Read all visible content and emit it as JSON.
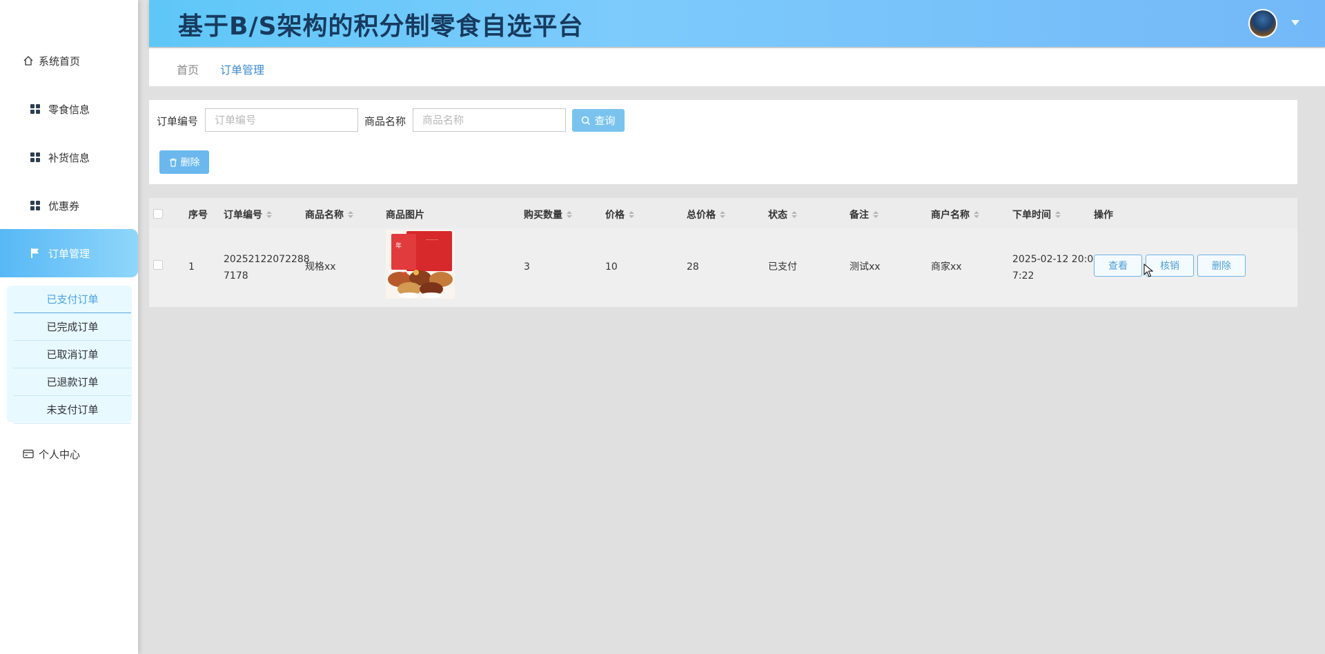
{
  "header": {
    "title": "基于B/S架构的积分制零食自选平台"
  },
  "sidebar": {
    "items": {
      "home": "系统首页",
      "snack": "零食信息",
      "restock": "补货信息",
      "coupon": "优惠券",
      "orders": "订单管理",
      "profile": "个人中心"
    },
    "submenu": [
      "已支付订单",
      "已完成订单",
      "已取消订单",
      "已退款订单",
      "未支付订单"
    ]
  },
  "breadcrumb": {
    "home": "首页",
    "current": "订单管理"
  },
  "search": {
    "order_no_label": "订单编号",
    "order_no_placeholder": "订单编号",
    "product_label": "商品名称",
    "product_placeholder": "商品名称",
    "search_button": "查询",
    "delete_button": "删除"
  },
  "table": {
    "columns": {
      "index": "序号",
      "order_no": "订单编号",
      "product": "商品名称",
      "image": "商品图片",
      "quantity": "购买数量",
      "price": "价格",
      "total": "总价格",
      "status": "状态",
      "remark": "备注",
      "merchant": "商户名称",
      "time": "下单时间",
      "actions": "操作"
    },
    "rows": [
      {
        "index": "1",
        "order_no_line1": "20252122072288",
        "order_no_line2": "7178",
        "product": "规格xx",
        "quantity": "3",
        "price": "10",
        "total": "28",
        "status": "已支付",
        "remark": "测试xx",
        "merchant": "商家xx",
        "time_line1": "2025-02-12 20:0",
        "time_line2": "7:22",
        "view": "查看",
        "verify": "核销",
        "delete": "删除"
      }
    ]
  },
  "colors": {
    "header_gradient_start": "#5ec7f8",
    "active_menu": "#57b8f5",
    "title": "#173a5e",
    "link_blue": "#3a8ad0"
  }
}
